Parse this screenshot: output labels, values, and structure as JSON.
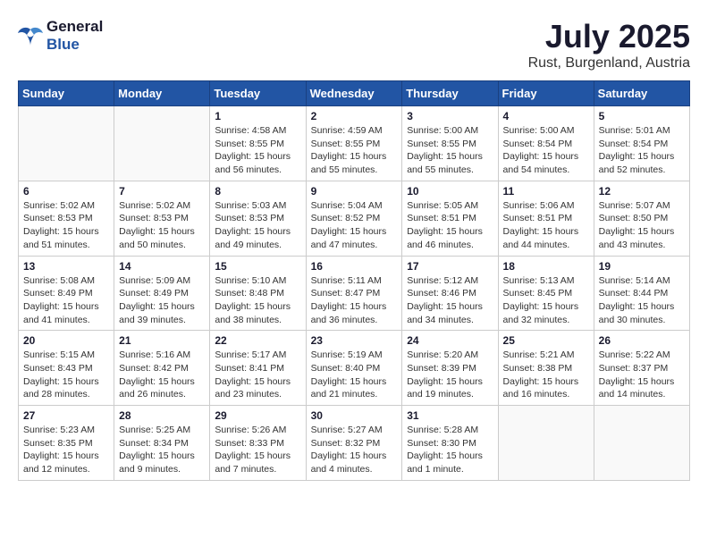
{
  "header": {
    "logo_general": "General",
    "logo_blue": "Blue",
    "month_title": "July 2025",
    "location": "Rust, Burgenland, Austria"
  },
  "weekdays": [
    "Sunday",
    "Monday",
    "Tuesday",
    "Wednesday",
    "Thursday",
    "Friday",
    "Saturday"
  ],
  "weeks": [
    [
      {
        "day": "",
        "content": ""
      },
      {
        "day": "",
        "content": ""
      },
      {
        "day": "1",
        "content": "Sunrise: 4:58 AM\nSunset: 8:55 PM\nDaylight: 15 hours and 56 minutes."
      },
      {
        "day": "2",
        "content": "Sunrise: 4:59 AM\nSunset: 8:55 PM\nDaylight: 15 hours and 55 minutes."
      },
      {
        "day": "3",
        "content": "Sunrise: 5:00 AM\nSunset: 8:55 PM\nDaylight: 15 hours and 55 minutes."
      },
      {
        "day": "4",
        "content": "Sunrise: 5:00 AM\nSunset: 8:54 PM\nDaylight: 15 hours and 54 minutes."
      },
      {
        "day": "5",
        "content": "Sunrise: 5:01 AM\nSunset: 8:54 PM\nDaylight: 15 hours and 52 minutes."
      }
    ],
    [
      {
        "day": "6",
        "content": "Sunrise: 5:02 AM\nSunset: 8:53 PM\nDaylight: 15 hours and 51 minutes."
      },
      {
        "day": "7",
        "content": "Sunrise: 5:02 AM\nSunset: 8:53 PM\nDaylight: 15 hours and 50 minutes."
      },
      {
        "day": "8",
        "content": "Sunrise: 5:03 AM\nSunset: 8:53 PM\nDaylight: 15 hours and 49 minutes."
      },
      {
        "day": "9",
        "content": "Sunrise: 5:04 AM\nSunset: 8:52 PM\nDaylight: 15 hours and 47 minutes."
      },
      {
        "day": "10",
        "content": "Sunrise: 5:05 AM\nSunset: 8:51 PM\nDaylight: 15 hours and 46 minutes."
      },
      {
        "day": "11",
        "content": "Sunrise: 5:06 AM\nSunset: 8:51 PM\nDaylight: 15 hours and 44 minutes."
      },
      {
        "day": "12",
        "content": "Sunrise: 5:07 AM\nSunset: 8:50 PM\nDaylight: 15 hours and 43 minutes."
      }
    ],
    [
      {
        "day": "13",
        "content": "Sunrise: 5:08 AM\nSunset: 8:49 PM\nDaylight: 15 hours and 41 minutes."
      },
      {
        "day": "14",
        "content": "Sunrise: 5:09 AM\nSunset: 8:49 PM\nDaylight: 15 hours and 39 minutes."
      },
      {
        "day": "15",
        "content": "Sunrise: 5:10 AM\nSunset: 8:48 PM\nDaylight: 15 hours and 38 minutes."
      },
      {
        "day": "16",
        "content": "Sunrise: 5:11 AM\nSunset: 8:47 PM\nDaylight: 15 hours and 36 minutes."
      },
      {
        "day": "17",
        "content": "Sunrise: 5:12 AM\nSunset: 8:46 PM\nDaylight: 15 hours and 34 minutes."
      },
      {
        "day": "18",
        "content": "Sunrise: 5:13 AM\nSunset: 8:45 PM\nDaylight: 15 hours and 32 minutes."
      },
      {
        "day": "19",
        "content": "Sunrise: 5:14 AM\nSunset: 8:44 PM\nDaylight: 15 hours and 30 minutes."
      }
    ],
    [
      {
        "day": "20",
        "content": "Sunrise: 5:15 AM\nSunset: 8:43 PM\nDaylight: 15 hours and 28 minutes."
      },
      {
        "day": "21",
        "content": "Sunrise: 5:16 AM\nSunset: 8:42 PM\nDaylight: 15 hours and 26 minutes."
      },
      {
        "day": "22",
        "content": "Sunrise: 5:17 AM\nSunset: 8:41 PM\nDaylight: 15 hours and 23 minutes."
      },
      {
        "day": "23",
        "content": "Sunrise: 5:19 AM\nSunset: 8:40 PM\nDaylight: 15 hours and 21 minutes."
      },
      {
        "day": "24",
        "content": "Sunrise: 5:20 AM\nSunset: 8:39 PM\nDaylight: 15 hours and 19 minutes."
      },
      {
        "day": "25",
        "content": "Sunrise: 5:21 AM\nSunset: 8:38 PM\nDaylight: 15 hours and 16 minutes."
      },
      {
        "day": "26",
        "content": "Sunrise: 5:22 AM\nSunset: 8:37 PM\nDaylight: 15 hours and 14 minutes."
      }
    ],
    [
      {
        "day": "27",
        "content": "Sunrise: 5:23 AM\nSunset: 8:35 PM\nDaylight: 15 hours and 12 minutes."
      },
      {
        "day": "28",
        "content": "Sunrise: 5:25 AM\nSunset: 8:34 PM\nDaylight: 15 hours and 9 minutes."
      },
      {
        "day": "29",
        "content": "Sunrise: 5:26 AM\nSunset: 8:33 PM\nDaylight: 15 hours and 7 minutes."
      },
      {
        "day": "30",
        "content": "Sunrise: 5:27 AM\nSunset: 8:32 PM\nDaylight: 15 hours and 4 minutes."
      },
      {
        "day": "31",
        "content": "Sunrise: 5:28 AM\nSunset: 8:30 PM\nDaylight: 15 hours and 1 minute."
      },
      {
        "day": "",
        "content": ""
      },
      {
        "day": "",
        "content": ""
      }
    ]
  ]
}
